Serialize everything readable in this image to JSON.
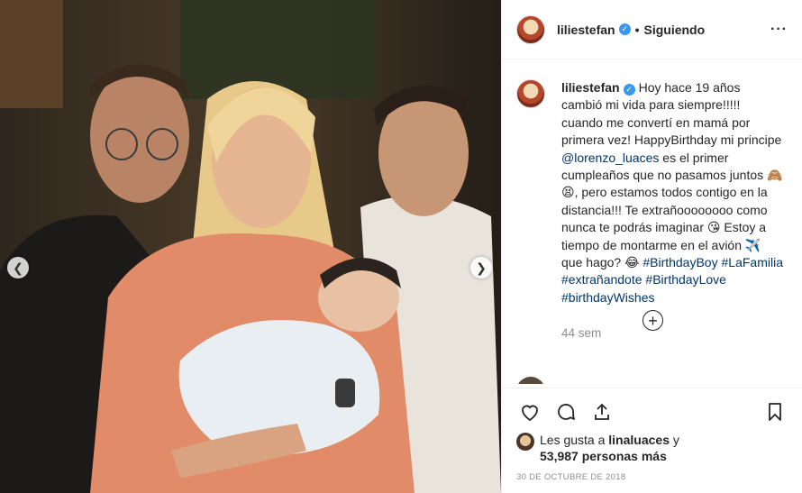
{
  "post": {
    "username": "liliestefan",
    "follow_status": "Siguiendo",
    "more_icon": "more-options-icon",
    "caption_parts": {
      "p1": "Hoy hace 19 años cambió mi vida para siempre!!!!! cuando me convertí en mamá por primera vez! HappyBirthday mi principe",
      "mention": "@lorenzo_luaces",
      "p2": "es el primer cumpleaños que no pasamos juntos",
      "emoji1": "🙈😫",
      "p3": ", pero estamos todos contigo en la distancia!!! Te extrañoooooooo como nunca te podrás imaginar",
      "emoji2": "😘",
      "p4": "Estoy a tiempo de montarme en el avión",
      "emoji3": "✈️",
      "p5": "que hago?",
      "emoji4": "😂",
      "tag1": "#BirthdayBoy",
      "tag2": "#LaFamilia",
      "tag3": "#extrañandote",
      "tag4": "#BirthdayLove",
      "tag5": "#birthdayWishes"
    },
    "time_ago": "44 sem",
    "likes_prefix": "Les gusta a",
    "likes_user": "linaluaces",
    "likes_and": "y",
    "likes_count": "53,987 personas más",
    "date": "30 de octubre de 2018"
  },
  "colors": {
    "link": "#003569",
    "verified": "#3897f0",
    "muted": "#8e8e8e"
  }
}
